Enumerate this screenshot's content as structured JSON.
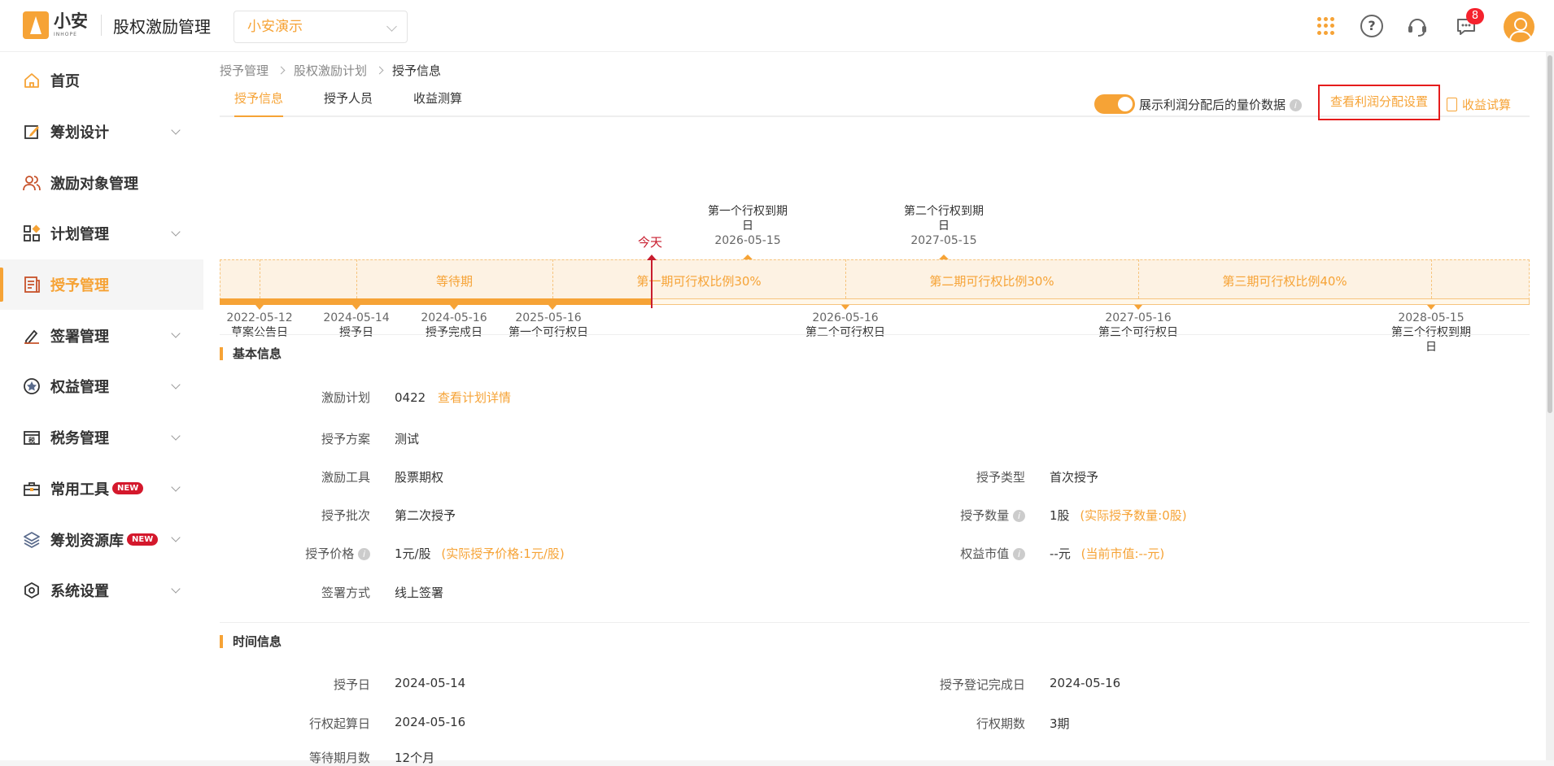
{
  "header": {
    "logo_name": "小安",
    "logo_sub": "INHOPE",
    "app_title": "股权激励管理",
    "company": "小安演示",
    "message_count": "8",
    "icons": [
      "apps-grid-icon",
      "help-icon",
      "customer-service-icon",
      "message-icon",
      "avatar"
    ]
  },
  "sidebar": {
    "items": [
      {
        "label": "首页",
        "icon": "home-icon",
        "expandable": false
      },
      {
        "label": "筹划设计",
        "icon": "edit-icon",
        "expandable": true
      },
      {
        "label": "激励对象管理",
        "icon": "users-icon",
        "expandable": false
      },
      {
        "label": "计划管理",
        "icon": "apps-icon",
        "expandable": true
      },
      {
        "label": "授予管理",
        "icon": "document-icon",
        "expandable": false,
        "active": true
      },
      {
        "label": "签署管理",
        "icon": "sign-icon",
        "expandable": true
      },
      {
        "label": "权益管理",
        "icon": "rights-icon",
        "expandable": true
      },
      {
        "label": "税务管理",
        "icon": "tax-icon",
        "expandable": true
      },
      {
        "label": "常用工具",
        "icon": "toolbox-icon",
        "expandable": true,
        "badge": "NEW"
      },
      {
        "label": "筹划资源库",
        "icon": "layers-icon",
        "expandable": true,
        "badge": "NEW"
      },
      {
        "label": "系统设置",
        "icon": "settings-icon",
        "expandable": true
      }
    ]
  },
  "breadcrumb": [
    "授予管理",
    "股权激励计划",
    "授予信息"
  ],
  "tabs": [
    "授予信息",
    "授予人员",
    "收益测算"
  ],
  "toolbar": {
    "toggle_label": "展示利润分配后的量价数据",
    "toggle_on": true,
    "profit_button": "查看利润分配设置",
    "calc_link": "收益试算"
  },
  "timeline": {
    "today_label": "今天",
    "periods": [
      "等待期",
      "第一期可行权比例30%",
      "第二期可行权比例30%",
      "第三期可行权比例40%"
    ],
    "events_below": [
      {
        "date": "2022-05-12",
        "label": "草案公告日"
      },
      {
        "date": "2024-05-14",
        "label": "授予日"
      },
      {
        "date": "2024-05-16",
        "label": "授予完成日"
      },
      {
        "date": "2025-05-16",
        "label": "第一个可行权日"
      },
      {
        "date": "2026-05-16",
        "label": "第二个可行权日"
      },
      {
        "date": "2027-05-16",
        "label": "第三个可行权日"
      },
      {
        "date": "2028-05-15",
        "label": "第三个行权到期日"
      }
    ],
    "events_above": [
      {
        "label": "第一个行权到期日",
        "date": "2026-05-15"
      },
      {
        "label": "第二个行权到期日",
        "date": "2027-05-15"
      }
    ]
  },
  "basic_info": {
    "title": "基本信息",
    "plan_label": "激励计划",
    "plan_value": "0422",
    "plan_link": "查看计划详情",
    "scheme_label": "授予方案",
    "scheme_value": "测试",
    "tool_label": "激励工具",
    "tool_value": "股票期权",
    "type_label": "授予类型",
    "type_value": "首次授予",
    "batch_label": "授予批次",
    "batch_value": "第二次授予",
    "qty_label": "授予数量",
    "qty_value": "1股",
    "qty_note": "(实际授予数量:0股)",
    "price_label": "授予价格",
    "price_value": "1元/股",
    "price_note": "(实际授予价格:1元/股)",
    "mv_label": "权益市值",
    "mv_value": "--元",
    "mv_note": "(当前市值:--元)",
    "sign_label": "签署方式",
    "sign_value": "线上签署"
  },
  "time_info": {
    "title": "时间信息",
    "grant_date_label": "授予日",
    "grant_date_value": "2024-05-14",
    "reg_label": "授予登记完成日",
    "reg_value": "2024-05-16",
    "start_label": "行权起算日",
    "start_value": "2024-05-16",
    "periods_label": "行权期数",
    "periods_value": "3期",
    "wait_label": "等待期月数",
    "wait_value": "12个月"
  },
  "colors": {
    "accent": "#f6a336",
    "today": "#c81d2e",
    "highlight_border": "#e51c1c",
    "badge": "#f5222d"
  }
}
